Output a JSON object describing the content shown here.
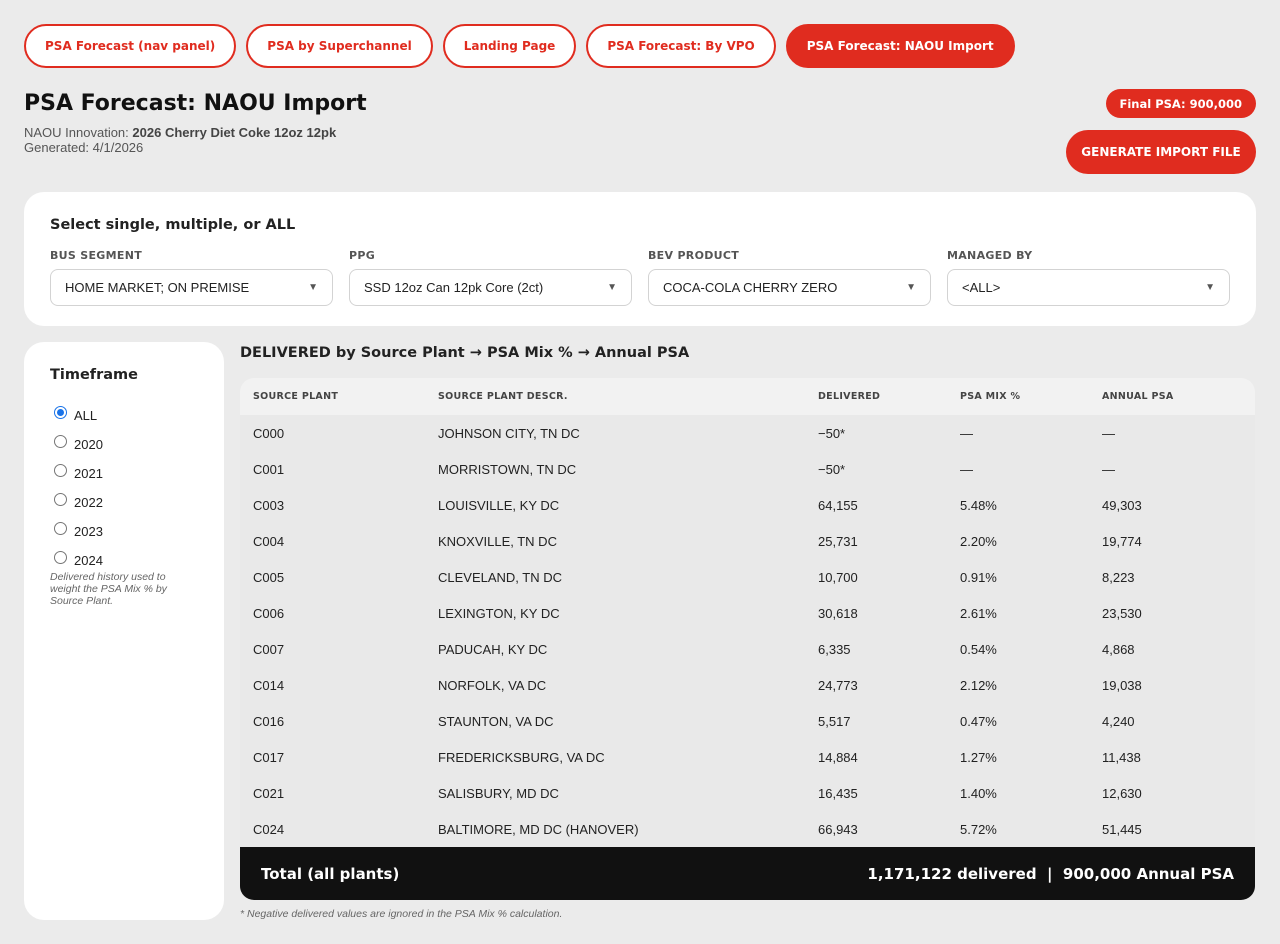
{
  "nav": {
    "tabs": [
      {
        "label": "PSA Forecast (nav panel)",
        "active": false
      },
      {
        "label": "PSA by Superchannel",
        "active": false
      },
      {
        "label": "Landing Page",
        "active": false
      },
      {
        "label": "PSA Forecast: By VPO",
        "active": false
      },
      {
        "label": "PSA Forecast: NAOU Import",
        "active": true
      }
    ]
  },
  "header": {
    "title": "PSA Forecast: NAOU Import",
    "innovation_label": "NAOU Innovation:",
    "innovation_value": "2026 Cherry Diet Coke 12oz 12pk",
    "generated": "Generated: 4/1/2026",
    "final_psa_badge": "Final PSA: 900,000",
    "generate_button": "GENERATE IMPORT FILE"
  },
  "filters": {
    "heading": "Select single, multiple, or ALL",
    "groups": [
      {
        "label": "BUS SEGMENT",
        "value": "HOME MARKET; ON PREMISE"
      },
      {
        "label": "PPG",
        "value": "SSD 12oz Can 12pk Core (2ct)"
      },
      {
        "label": "BEV PRODUCT",
        "value": "COCA-COLA CHERRY ZERO"
      },
      {
        "label": "MANAGED BY",
        "value": "<ALL>"
      }
    ]
  },
  "timeframe": {
    "heading": "Timeframe",
    "options": [
      {
        "label": "ALL",
        "checked": true
      },
      {
        "label": "2020",
        "checked": false
      },
      {
        "label": "2021",
        "checked": false
      },
      {
        "label": "2022",
        "checked": false
      },
      {
        "label": "2023",
        "checked": false
      },
      {
        "label": "2024",
        "checked": false
      }
    ],
    "note": "Delivered history used to weight the PSA Mix % by Source Plant."
  },
  "table": {
    "title": "DELIVERED by Source Plant → PSA Mix % → Annual PSA",
    "columns": [
      "SOURCE PLANT",
      "SOURCE PLANT DESCR.",
      "DELIVERED",
      "PSA MIX %",
      "ANNUAL PSA"
    ],
    "rows": [
      [
        "C000",
        "JOHNSON CITY, TN DC",
        "−50*",
        "—",
        "—"
      ],
      [
        "C001",
        "MORRISTOWN, TN DC",
        "−50*",
        "—",
        "—"
      ],
      [
        "C003",
        "LOUISVILLE, KY DC",
        "64,155",
        "5.48%",
        "49,303"
      ],
      [
        "C004",
        "KNOXVILLE, TN DC",
        "25,731",
        "2.20%",
        "19,774"
      ],
      [
        "C005",
        "CLEVELAND, TN DC",
        "10,700",
        "0.91%",
        "8,223"
      ],
      [
        "C006",
        "LEXINGTON, KY DC",
        "30,618",
        "2.61%",
        "23,530"
      ],
      [
        "C007",
        "PADUCAH, KY DC",
        "6,335",
        "0.54%",
        "4,868"
      ],
      [
        "C014",
        "NORFOLK, VA DC",
        "24,773",
        "2.12%",
        "19,038"
      ],
      [
        "C016",
        "STAUNTON, VA DC",
        "5,517",
        "0.47%",
        "4,240"
      ],
      [
        "C017",
        "FREDERICKSBURG, VA DC",
        "14,884",
        "1.27%",
        "11,438"
      ],
      [
        "C021",
        "SALISBURY, MD DC",
        "16,435",
        "1.40%",
        "12,630"
      ],
      [
        "C024",
        "BALTIMORE, MD DC (HANOVER)",
        "66,943",
        "5.72%",
        "51,445"
      ]
    ],
    "total_label": "Total (all plants)",
    "total_value": "1,171,122 delivered  |  900,000 Annual PSA",
    "footnote": "* Negative delivered values are ignored in the PSA Mix % calculation."
  }
}
